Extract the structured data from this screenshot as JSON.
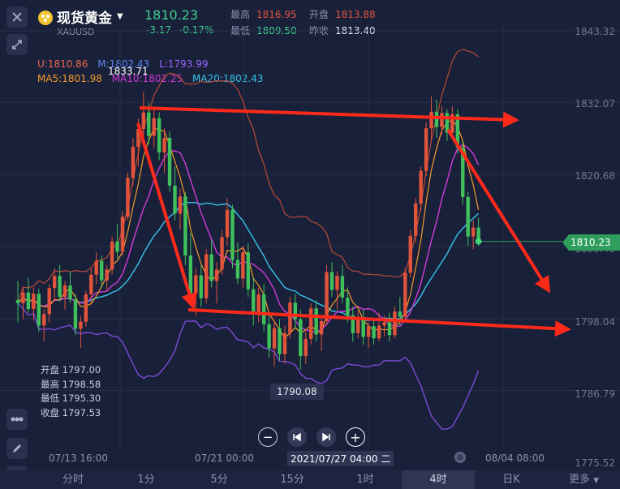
{
  "header": {
    "title": "现货黄金",
    "symbol": "XAUUSD",
    "price": "1810.23",
    "change": "-3.17",
    "change_pct": "-0.17%",
    "high_label": "最高",
    "high": "1816.95",
    "open_label": "开盘",
    "open": "1813.88",
    "low_label": "最低",
    "low": "1809.50",
    "prev_label": "昨收",
    "prev": "1813.40"
  },
  "indicators": {
    "boll": [
      {
        "label": "U:1810.86",
        "color": "#f06a50"
      },
      {
        "label": "M:1802.43",
        "color": "#5b86f0"
      },
      {
        "label": "L:1793.99",
        "color": "#9a63ff"
      }
    ],
    "ma": [
      {
        "label": "MA5:1801.98",
        "color": "#f39a2a"
      },
      {
        "label": "MA10:1802.25",
        "color": "#d13cd9"
      },
      {
        "label": "MA20:1802.43",
        "color": "#36c4e8"
      }
    ]
  },
  "axis": {
    "y_ticks": [
      "1843.32",
      "1832.07",
      "1820.68",
      "1809.43",
      "1798.04",
      "1786.79",
      "1775.52"
    ],
    "x_ticks": [
      "07/13 16:00",
      "07/21 00:00",
      "08/04 08:00"
    ],
    "crosshair_time": "2021/07/27 04:00 二",
    "current_price_label": "1810.23",
    "max_label": "1833.71",
    "min_label": "1790.08"
  },
  "ohlc_box": {
    "open": "开盘 1797.00",
    "high": "最高 1798.58",
    "low": "最低 1795.30",
    "close": "收盘 1797.53"
  },
  "controls": {
    "zoom_out": "minus-icon",
    "prev": "skip-back-icon",
    "next": "skip-forward-icon",
    "zoom_in": "plus-icon"
  },
  "tabs": [
    {
      "label": "分时",
      "active": false
    },
    {
      "label": "1分",
      "active": false
    },
    {
      "label": "5分",
      "active": false
    },
    {
      "label": "15分",
      "active": false
    },
    {
      "label": "1时",
      "active": false
    },
    {
      "label": "4时",
      "active": true
    },
    {
      "label": "日K",
      "active": false
    },
    {
      "label": "更多",
      "active": false
    }
  ],
  "colors": {
    "up": "#e2543a",
    "down": "#3fc05a",
    "arrow": "#ff2a1a",
    "bg": "#19203a"
  },
  "chart_data": {
    "type": "candlestick",
    "timeframe": "4时",
    "y_range": [
      1775.52,
      1843.32
    ],
    "bars": [
      [
        1801.0,
        1804.0,
        1797.5,
        1800.5
      ],
      [
        1800.5,
        1803.0,
        1798.0,
        1802.2
      ],
      [
        1802.2,
        1804.5,
        1799.0,
        1799.6
      ],
      [
        1799.6,
        1803.0,
        1797.8,
        1802.0
      ],
      [
        1802.0,
        1802.8,
        1796.0,
        1797.0
      ],
      [
        1797.0,
        1799.5,
        1794.5,
        1798.8
      ],
      [
        1798.8,
        1803.5,
        1797.5,
        1802.9
      ],
      [
        1802.9,
        1806.0,
        1801.0,
        1804.8
      ],
      [
        1804.8,
        1806.5,
        1800.8,
        1801.5
      ],
      [
        1801.5,
        1804.0,
        1799.5,
        1803.3
      ],
      [
        1803.3,
        1805.5,
        1800.5,
        1801.1
      ],
      [
        1801.1,
        1802.0,
        1795.5,
        1796.5
      ],
      [
        1796.5,
        1798.5,
        1793.5,
        1797.6
      ],
      [
        1797.6,
        1802.5,
        1796.8,
        1801.9
      ],
      [
        1801.9,
        1806.0,
        1800.5,
        1805.0
      ],
      [
        1805.0,
        1808.5,
        1803.5,
        1807.2
      ],
      [
        1807.2,
        1808.0,
        1803.0,
        1804.1
      ],
      [
        1804.1,
        1806.5,
        1802.5,
        1805.8
      ],
      [
        1805.8,
        1811.0,
        1805.0,
        1810.2
      ],
      [
        1810.2,
        1813.0,
        1807.5,
        1808.6
      ],
      [
        1808.6,
        1815.0,
        1808.0,
        1814.1
      ],
      [
        1814.1,
        1821.0,
        1813.5,
        1820.2
      ],
      [
        1820.2,
        1826.5,
        1819.0,
        1825.1
      ],
      [
        1825.1,
        1829.5,
        1822.0,
        1827.9
      ],
      [
        1827.9,
        1833.71,
        1826.0,
        1830.5
      ],
      [
        1830.5,
        1832.0,
        1825.5,
        1826.8
      ],
      [
        1826.8,
        1831.0,
        1825.0,
        1829.6
      ],
      [
        1829.6,
        1830.5,
        1823.0,
        1824.2
      ],
      [
        1824.2,
        1828.0,
        1821.0,
        1826.5
      ],
      [
        1826.5,
        1827.5,
        1818.0,
        1819.0
      ],
      [
        1819.0,
        1822.0,
        1813.5,
        1814.6
      ],
      [
        1814.6,
        1818.5,
        1812.0,
        1817.3
      ],
      [
        1817.3,
        1818.0,
        1806.5,
        1808.0
      ],
      [
        1808.0,
        1811.5,
        1801.0,
        1802.1
      ],
      [
        1802.1,
        1806.0,
        1798.5,
        1804.9
      ],
      [
        1804.9,
        1806.5,
        1800.0,
        1801.3
      ],
      [
        1801.3,
        1809.0,
        1800.5,
        1808.2
      ],
      [
        1808.2,
        1810.5,
        1803.0,
        1804.0
      ],
      [
        1804.0,
        1807.0,
        1800.5,
        1805.8
      ],
      [
        1805.8,
        1812.0,
        1805.0,
        1810.9
      ],
      [
        1810.9,
        1817.0,
        1809.5,
        1815.2
      ],
      [
        1815.2,
        1816.0,
        1806.0,
        1807.3
      ],
      [
        1807.3,
        1810.0,
        1803.5,
        1804.4
      ],
      [
        1804.4,
        1809.5,
        1803.0,
        1808.5
      ],
      [
        1808.5,
        1810.0,
        1801.5,
        1802.7
      ],
      [
        1802.7,
        1804.5,
        1797.0,
        1799.1
      ],
      [
        1799.1,
        1803.0,
        1797.5,
        1801.9
      ],
      [
        1801.9,
        1803.5,
        1796.0,
        1797.2
      ],
      [
        1797.2,
        1799.0,
        1792.0,
        1793.4
      ],
      [
        1793.4,
        1797.5,
        1790.5,
        1796.6
      ],
      [
        1796.6,
        1798.0,
        1791.5,
        1792.5
      ],
      [
        1792.5,
        1797.0,
        1791.0,
        1795.8
      ],
      [
        1795.8,
        1801.5,
        1795.0,
        1800.6
      ],
      [
        1800.6,
        1802.0,
        1796.5,
        1798.0
      ],
      [
        1798.0,
        1799.5,
        1790.08,
        1792.2
      ],
      [
        1792.2,
        1796.0,
        1791.0,
        1794.9
      ],
      [
        1794.9,
        1800.5,
        1794.0,
        1799.7
      ],
      [
        1799.7,
        1801.0,
        1794.5,
        1795.6
      ],
      [
        1795.6,
        1798.5,
        1793.0,
        1797.7
      ],
      [
        1797.7,
        1806.5,
        1797.0,
        1805.4
      ],
      [
        1805.4,
        1807.0,
        1801.5,
        1802.6
      ],
      [
        1802.6,
        1805.5,
        1799.5,
        1804.8
      ],
      [
        1804.8,
        1806.5,
        1800.5,
        1801.4
      ],
      [
        1801.4,
        1803.0,
        1797.5,
        1798.6
      ],
      [
        1798.6,
        1800.0,
        1794.5,
        1795.8
      ],
      [
        1795.8,
        1799.5,
        1795.0,
        1798.3
      ],
      [
        1798.3,
        1799.5,
        1794.0,
        1795.2
      ],
      [
        1795.2,
        1797.5,
        1793.5,
        1796.9
      ],
      [
        1796.9,
        1798.0,
        1794.0,
        1795.0
      ],
      [
        1795.0,
        1799.0,
        1794.5,
        1797.0
      ],
      [
        1797.0,
        1798.58,
        1795.3,
        1797.53
      ],
      [
        1797.53,
        1799.0,
        1794.5,
        1795.5
      ],
      [
        1795.5,
        1800.0,
        1795.0,
        1799.2
      ],
      [
        1799.2,
        1801.5,
        1797.0,
        1798.4
      ],
      [
        1798.4,
        1806.0,
        1797.5,
        1805.3
      ],
      [
        1805.3,
        1812.0,
        1804.5,
        1811.1
      ],
      [
        1811.1,
        1817.0,
        1810.0,
        1816.2
      ],
      [
        1816.2,
        1822.0,
        1815.0,
        1821.3
      ],
      [
        1821.3,
        1829.0,
        1820.5,
        1828.0
      ],
      [
        1828.0,
        1833.0,
        1826.0,
        1830.6
      ],
      [
        1830.6,
        1832.5,
        1826.5,
        1828.2
      ],
      [
        1828.2,
        1831.5,
        1827.0,
        1830.4
      ],
      [
        1830.4,
        1831.0,
        1826.0,
        1827.3
      ],
      [
        1827.3,
        1831.5,
        1826.5,
        1830.2
      ],
      [
        1830.2,
        1831.0,
        1824.0,
        1825.0
      ],
      [
        1825.0,
        1826.0,
        1816.0,
        1817.2
      ],
      [
        1817.2,
        1818.0,
        1809.5,
        1811.0
      ],
      [
        1811.0,
        1813.5,
        1809.0,
        1812.4
      ],
      [
        1812.4,
        1813.88,
        1809.5,
        1810.23
      ]
    ],
    "overlays": [
      "BOLL upper",
      "BOLL middle",
      "BOLL lower",
      "MA5",
      "MA10",
      "MA20"
    ]
  }
}
